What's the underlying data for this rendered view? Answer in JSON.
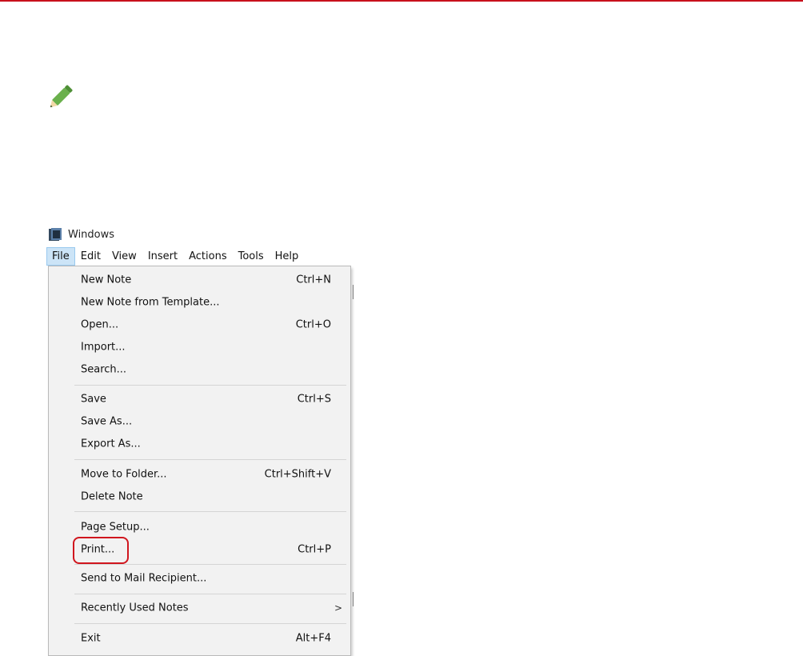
{
  "window": {
    "title": "Windows",
    "icon": "notes-app-icon"
  },
  "menubar": [
    {
      "label": "File",
      "active": true
    },
    {
      "label": "Edit"
    },
    {
      "label": "View"
    },
    {
      "label": "Insert"
    },
    {
      "label": "Actions"
    },
    {
      "label": "Tools"
    },
    {
      "label": "Help"
    }
  ],
  "file_menu": {
    "items": [
      {
        "label": "New Note",
        "shortcut": "Ctrl+N"
      },
      {
        "label": "New Note from Template..."
      },
      {
        "label": "Open...",
        "shortcut": "Ctrl+O"
      },
      {
        "label": "Import..."
      },
      {
        "label": "Search..."
      },
      {
        "label": "Save",
        "shortcut": "Ctrl+S"
      },
      {
        "label": "Save As..."
      },
      {
        "label": "Export As..."
      },
      {
        "label": "Move to Folder...",
        "shortcut": "Ctrl+Shift+V"
      },
      {
        "label": "Delete Note"
      },
      {
        "label": "Page Setup..."
      },
      {
        "label": "Print...",
        "shortcut": "Ctrl+P",
        "highlighted": true
      },
      {
        "label": "Send to Mail Recipient..."
      },
      {
        "label": "Recently Used Notes",
        "submenu": true,
        "arrow": ">"
      },
      {
        "label": "Exit",
        "shortcut": "Alt+F4"
      }
    ]
  },
  "colors": {
    "accent_rule": "#c8101c",
    "pencil": "#6ab04c",
    "highlight_box": "#d0161e",
    "active_menu_bg": "#cce4f7"
  }
}
